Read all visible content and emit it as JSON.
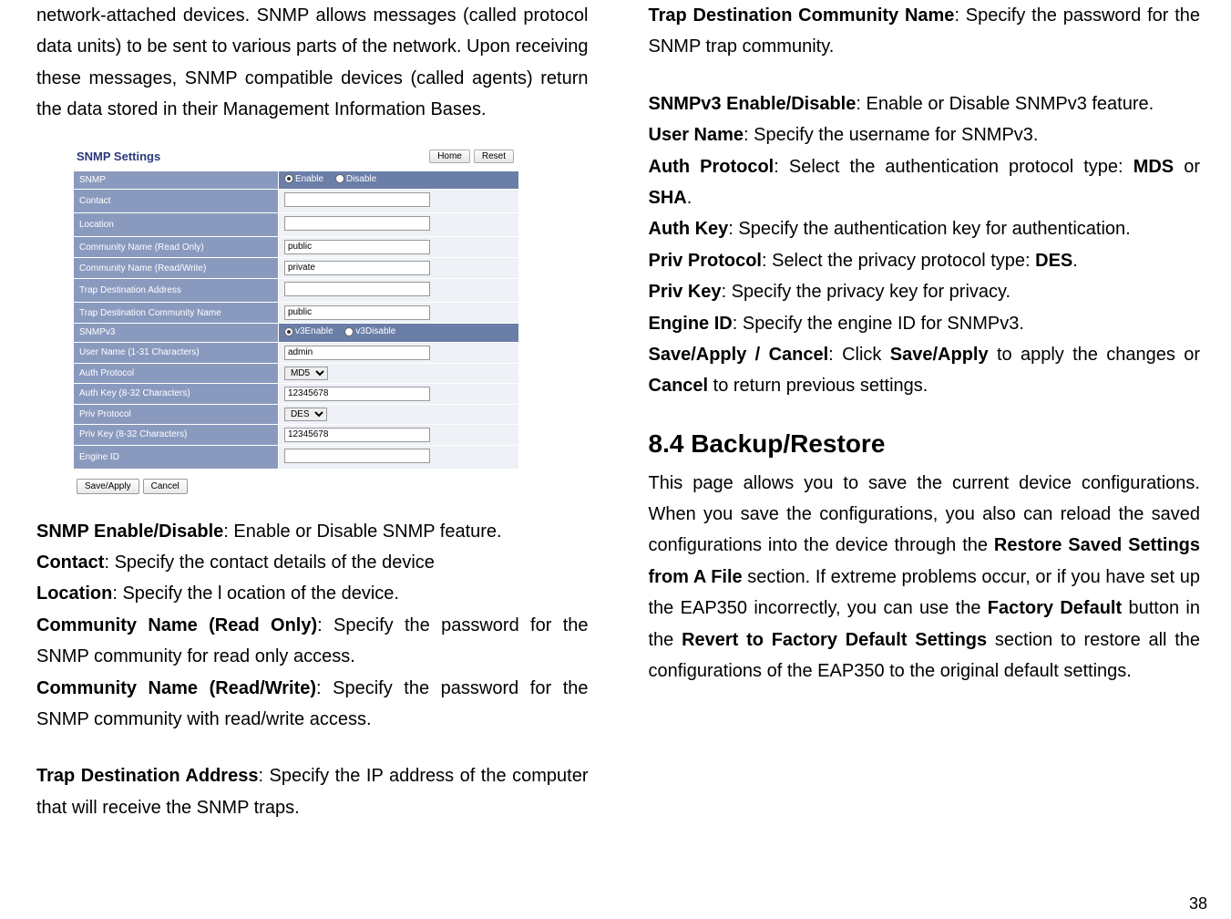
{
  "leftIntro": "network-attached devices. SNMP allows messages (called protocol data units) to be sent to various parts of the network. Upon receiving these messages, SNMP compatible devices (called agents) return the data stored in their Management Information Bases.",
  "screenshot": {
    "title": "SNMP Settings",
    "btnHome": "Home",
    "btnReset": "Reset",
    "rows": {
      "snmp": "SNMP",
      "enable": "Enable",
      "disable": "Disable",
      "contact": "Contact",
      "location": "Location",
      "cnro": "Community Name (Read Only)",
      "cnroVal": "public",
      "cnrw": "Community Name (Read/Write)",
      "cnrwVal": "private",
      "tda": "Trap Destination Address",
      "tdcn": "Trap Destination Community Name",
      "tdcnVal": "public",
      "snmpv3": "SNMPv3",
      "v3enable": "v3Enable",
      "v3disable": "v3Disable",
      "user": "User Name (1-31 Characters)",
      "userVal": "admin",
      "authp": "Auth Protocol",
      "authpVal": "MD5",
      "authk": "Auth Key (8-32 Characters)",
      "authkVal": "12345678",
      "privp": "Priv Protocol",
      "privpVal": "DES",
      "privk": "Priv Key (8-32 Characters)",
      "privkVal": "12345678",
      "engine": "Engine ID"
    },
    "btnSave": "Save/Apply",
    "btnCancel": "Cancel"
  },
  "leftDefs": {
    "d1b": "SNMP Enable/Disable",
    "d1t": ": Enable or Disable SNMP feature.",
    "d2b": "Contact",
    "d2t": ": Specify the contact details of the device",
    "d3b": "Location",
    "d3t": ": Specify the l ocation of the device.",
    "d4b": "Community Name (Read Only)",
    "d4t": ": Specify the password for the SNMP community for read only access.",
    "d5b": "Community Name (Read/Write)",
    "d5t": ": Specify the password for the SNMP community with read/write access.",
    "d6b": "Trap Destination Address",
    "d6t": ": Specify the IP address of the computer that will receive the SNMP traps."
  },
  "rightDefs": {
    "r1b": "Trap Destination Community Name",
    "r1t": ": Specify the password for the SNMP trap community.",
    "r2b": "SNMPv3 Enable/Disable",
    "r2t": ": Enable or Disable SNMPv3 feature.",
    "r3b": "User Name",
    "r3t": ": Specify the username for SNMPv3.",
    "r4b": "Auth Protocol",
    "r4t1": ": Select the authentication protocol type: ",
    "r4b2": "MDS",
    "r4t2": " or ",
    "r4b3": "SHA",
    "r4t3": ".",
    "r5b": "Auth Key",
    "r5t": ": Specify the authentication key for authentication.",
    "r6b": "Priv Protocol",
    "r6t1": ": Select the privacy protocol type: ",
    "r6b2": "DES",
    "r6t2": ".",
    "r7b": "Priv Key",
    "r7t": ": Specify the privacy key for privacy.",
    "r8b": "Engine ID",
    "r8t": ": Specify the engine ID for SNMPv3.",
    "r9b": "Save/Apply / Cancel",
    "r9t1": ": Click ",
    "r9b2": "Save/Apply",
    "r9t2": " to apply the changes or ",
    "r9b3": "Cancel",
    "r9t3": " to return previous settings."
  },
  "section": "8.4    Backup/Restore",
  "sectionBody1": "This page allows you to save the current device configurations. When you save the configurations, you also can reload the saved configurations into the device through the ",
  "sectionB1": "Restore Saved Settings from A File",
  "sectionBody2": " section. If extreme problems occur, or if you have set up the EAP350 incorrectly, you can use the ",
  "sectionB2": "Factory Default",
  "sectionBody3": " button in the ",
  "sectionB3": "Revert to Factory Default Settings",
  "sectionBody4": " section to restore all the configurations of the EAP350 to the original default settings.",
  "pageNumber": "38"
}
